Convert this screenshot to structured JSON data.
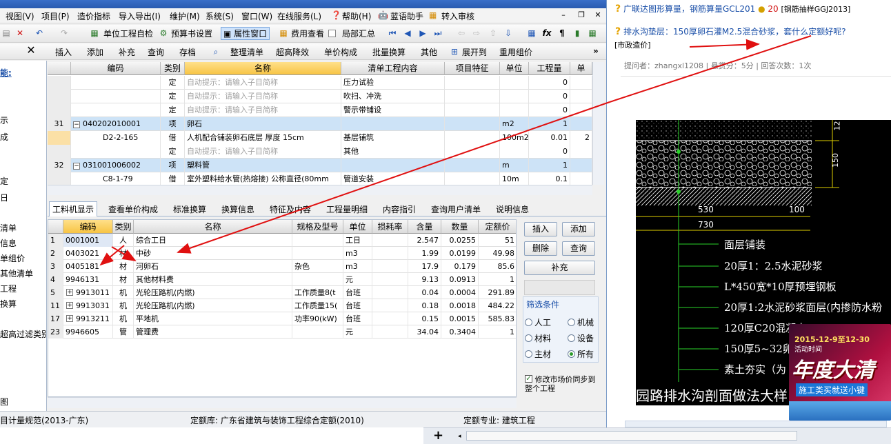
{
  "menubar": {
    "items": [
      "视图(V)",
      "项目(P)",
      "造价指标",
      "导入导出(I)",
      "维护(M)",
      "系统(S)",
      "窗口(W)",
      "在线服务(L)",
      "帮助(H)",
      "蓝语助手",
      "转入审核"
    ]
  },
  "toolbar1": {
    "check": "单位工程自检",
    "budget_settings": "预算书设置",
    "property_window": "属性窗口",
    "fee_view": "费用查看",
    "partial_summary": "局部汇总"
  },
  "toolbar2": {
    "items": [
      "插入",
      "添加",
      "补充",
      "查询",
      "存档",
      "整理清单",
      "超高降效",
      "单价构成",
      "批量换算",
      "其他",
      "展开到",
      "重用组价"
    ]
  },
  "left_panel": {
    "items": [
      "能:",
      "示",
      "成",
      "定",
      "日",
      "清单",
      "信息",
      "单组价",
      "其他清单",
      "工程",
      "换算",
      "超高过滤类别",
      "图"
    ]
  },
  "grid1": {
    "headers": [
      "编码",
      "类别",
      "名称",
      "清单工程内容",
      "项目特征",
      "单位",
      "工程量",
      "单"
    ],
    "rows": [
      {
        "no": "",
        "code": "",
        "type": "定",
        "name": "自动提示：请输入子目简称",
        "content": "压力试验",
        "unit": "",
        "qty": "0",
        "hint": true,
        "style": "plain"
      },
      {
        "no": "",
        "code": "",
        "type": "定",
        "name": "自动提示：请输入子目简称",
        "content": "吹扫、冲洗",
        "unit": "",
        "qty": "0",
        "hint": true,
        "style": "plain"
      },
      {
        "no": "",
        "code": "",
        "type": "定",
        "name": "自动提示：请输入子目简称",
        "content": "警示带铺设",
        "unit": "",
        "qty": "0",
        "hint": true,
        "style": "plain"
      },
      {
        "no": "31",
        "code": "040202010001",
        "type": "项",
        "name": "卵石",
        "content": "",
        "unit": "m2",
        "qty": "1",
        "hint": false,
        "style": "item"
      },
      {
        "no": "",
        "code": "D2-2-165",
        "type": "借",
        "name": "人机配合铺装卵石底层 厚度 15cm",
        "content": "基层铺筑",
        "unit": "100m2",
        "qty": "0.01",
        "extra": "2",
        "hint": false,
        "style": "selected"
      },
      {
        "no": "",
        "code": "",
        "type": "定",
        "name": "自动提示：请输入子目简称",
        "content": "其他",
        "unit": "",
        "qty": "0",
        "hint": true,
        "style": "plain"
      },
      {
        "no": "32",
        "code": "031001006002",
        "type": "项",
        "name": "塑料管",
        "content": "",
        "unit": "m",
        "qty": "1",
        "hint": false,
        "style": "item"
      },
      {
        "no": "",
        "code": "C8-1-79",
        "type": "借",
        "name": "室外塑料给水管(热熔接) 公称直径(80mm",
        "content": "管道安装",
        "unit": "10m",
        "qty": "0.1",
        "hint": false,
        "style": "plain"
      }
    ]
  },
  "tabs": [
    "工料机显示",
    "查看单价构成",
    "标准换算",
    "换算信息",
    "特征及内容",
    "工程量明细",
    "内容指引",
    "查询用户清单",
    "说明信息"
  ],
  "grid2": {
    "headers": [
      "编码",
      "类别",
      "名称",
      "规格及型号",
      "单位",
      "损耗率",
      "含量",
      "数量",
      "定额价"
    ],
    "rows": [
      {
        "no": "1",
        "code": "0001001",
        "type": "人",
        "name": "综合工日",
        "spec": "",
        "unit": "工日",
        "loss": "",
        "content": "2.547",
        "qty": "0.0255",
        "price": "51",
        "expand": false
      },
      {
        "no": "2",
        "code": "0403021",
        "type": "材",
        "name": "中砂",
        "spec": "",
        "unit": "m3",
        "loss": "",
        "content": "1.99",
        "qty": "0.0199",
        "price": "49.98",
        "expand": false
      },
      {
        "no": "3",
        "code": "0405181",
        "type": "材",
        "name": "河卵石",
        "spec": "杂色",
        "unit": "m3",
        "loss": "",
        "content": "17.9",
        "qty": "0.179",
        "price": "85.6",
        "expand": false
      },
      {
        "no": "4",
        "code": "9946131",
        "type": "材",
        "name": "其他材料费",
        "spec": "",
        "unit": "元",
        "loss": "",
        "content": "9.13",
        "qty": "0.0913",
        "price": "1",
        "expand": false
      },
      {
        "no": "5",
        "code": "9913011",
        "type": "机",
        "name": "光轮压路机(内燃)",
        "spec": "工作质量8(t",
        "unit": "台班",
        "loss": "",
        "content": "0.04",
        "qty": "0.0004",
        "price": "291.89",
        "expand": true
      },
      {
        "no": "11",
        "code": "9913031",
        "type": "机",
        "name": "光轮压路机(内燃)",
        "spec": "工作质量15(",
        "unit": "台班",
        "loss": "",
        "content": "0.18",
        "qty": "0.0018",
        "price": "484.22",
        "expand": true
      },
      {
        "no": "17",
        "code": "9913211",
        "type": "机",
        "name": "平地机",
        "spec": "功率90(kW)",
        "unit": "台班",
        "loss": "",
        "content": "0.15",
        "qty": "0.0015",
        "price": "585.83",
        "expand": true
      },
      {
        "no": "23",
        "code": "9946605",
        "type": "管",
        "name": "管理费",
        "spec": "",
        "unit": "元",
        "loss": "",
        "content": "34.04",
        "qty": "0.3404",
        "price": "1",
        "expand": false
      }
    ]
  },
  "side_buttons": {
    "insert": "插入",
    "add": "添加",
    "delete": "删除",
    "query": "查询",
    "supplement": "补充"
  },
  "filter": {
    "title": "筛选条件",
    "options": [
      "人工",
      "机械",
      "材料",
      "设备",
      "主材",
      "所有"
    ],
    "selected": "所有",
    "sync_label": "修改市场价同步到整个工程"
  },
  "statusbar": {
    "left": "目计量规范(2013-广东)",
    "quota_lib": "定额库: 广东省建筑与装饰工程综合定额(2010)",
    "quota_major": "定额专业: 建筑工程"
  },
  "browser": {
    "q1_text": "广联达图形算量，钢筋算量GCL201",
    "q1_score": "20",
    "q1_tag": "[钢筋抽样GGJ2013]",
    "q2_text": "排水沟垫层：150厚卵石灌M2.5混合砂浆，套什么定额好呢?",
    "q2_tag": "[市政造价]",
    "meta": "提问者：zhangxl1208   |  悬赏分：5分   |  回答次数：1次",
    "cad": {
      "dims": [
        "12",
        "150",
        "530",
        "100",
        "730"
      ],
      "layers": [
        "面层铺装",
        "20厚1：2.5水泥砂浆",
        "L*450宽*10厚预埋钢板",
        "20厚1:2水泥砂浆面层(内掺防水粉",
        "120厚C20混凝土",
        "150厚5~32卵石",
        "素土夯实（为",
        "园路排水沟剖面做法大样"
      ]
    },
    "promo": {
      "date": "2015-12-9至12-30",
      "sub": "活动时间",
      "title": "年度大清",
      "slogan": "施工类买就送小键"
    }
  },
  "colors": {
    "accent_blue": "#2a5bb0",
    "row_item_bg": "#cde3f7",
    "row_selected_bg": "#fbe0a6",
    "header_highlight": "#f7c444",
    "arrow_red": "#e01010",
    "link_blue": "#1a4fa8"
  }
}
